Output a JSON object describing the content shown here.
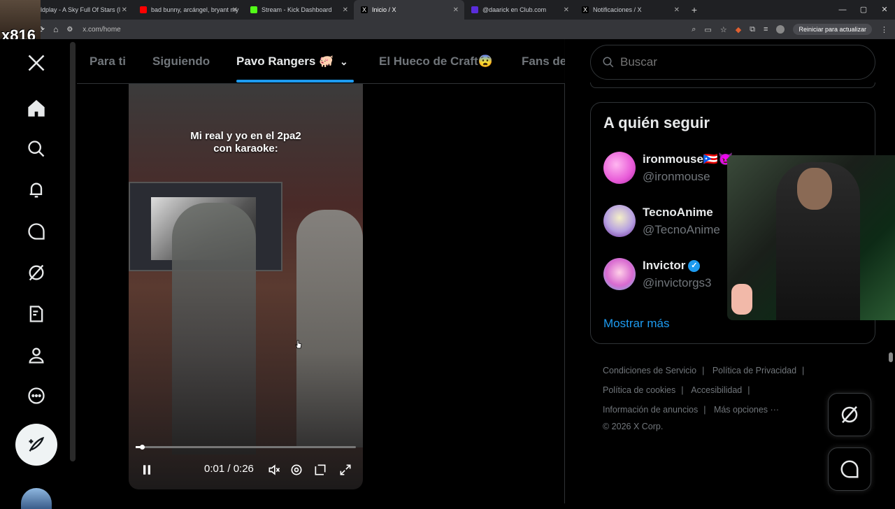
{
  "browser": {
    "tabs": [
      {
        "title": "ldplay - A Sky Full Of Stars (l",
        "fav_color": "#ff3b3b"
      },
      {
        "title": "bad bunny, arcángel, bryant my",
        "fav_color": "#ff0000"
      },
      {
        "title": "Stream - Kick Dashboard",
        "fav_color": "#53fc18"
      },
      {
        "title": "Inicio / X",
        "fav_color": "#ffffff"
      },
      {
        "title": "@daarick en Club.com",
        "fav_color": "#5a2ddb"
      },
      {
        "title": "Notificaciones / X",
        "fav_color": "#ffffff"
      }
    ],
    "tab_close": "✕",
    "new_tab": "+",
    "window_controls": [
      "—",
      "▢",
      "✕"
    ],
    "url": "x.com/home",
    "update_label": "Reiniciar para actualizar"
  },
  "overlay": {
    "streamer_tag": "x816"
  },
  "nav": {
    "icons": [
      "x-logo-icon",
      "home-icon",
      "search-icon",
      "bell-icon",
      "messages-icon",
      "grok-icon",
      "lists-icon",
      "profile-icon",
      "more-icon"
    ]
  },
  "feed_tabs": {
    "items": [
      "Para ti",
      "Siguiendo",
      "Pavo Rangers 🐖",
      "El Hueco de Craft😨",
      "Fans de"
    ],
    "active_index": 2
  },
  "video": {
    "caption_line1": "Mi real y yo en el 2pa2",
    "caption_line2": "con karaoke:",
    "time": "0:01 / 0:26",
    "progress": 0.03
  },
  "sidebar": {
    "search_placeholder": "Buscar",
    "who_to_follow": {
      "title": "A quién seguir",
      "users": [
        {
          "name": "ironmouse🇵🇷😈",
          "handle": "@ironmouse",
          "avatar_color": "#e85ad8",
          "verified": false
        },
        {
          "name": "TecnoAnime",
          "handle": "@TecnoAnime",
          "avatar_color": "#6a2a9a",
          "verified": false
        },
        {
          "name": "Invictor",
          "handle": "@invictorgs3",
          "avatar_color": "#d86ad0",
          "verified": true
        }
      ],
      "show_more": "Mostrar más"
    },
    "footer": {
      "terms": "Condiciones de Servicio",
      "privacy": "Política de Privacidad",
      "cookies": "Política de cookies",
      "accessibility": "Accesibilidad",
      "ads_info": "Información de anuncios",
      "more": "Más opciones ···",
      "copyright": "© 2026 X Corp.",
      "separator": "|"
    }
  },
  "colors": {
    "accent": "#1d9bf0",
    "background": "#000000",
    "border": "#2f3336",
    "muted_text": "#71767b"
  }
}
